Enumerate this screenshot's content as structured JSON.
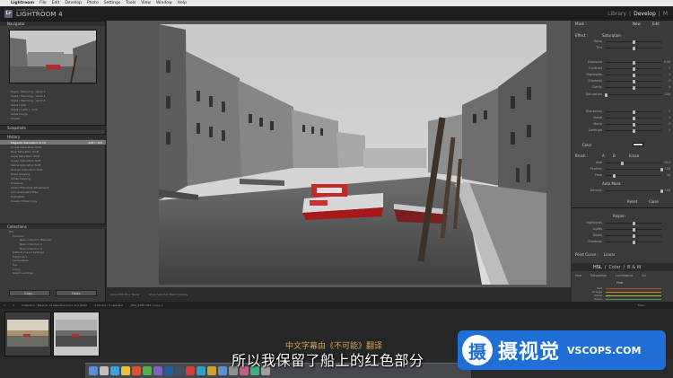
{
  "menubar": {
    "apple": "",
    "items": [
      "Lightroom",
      "File",
      "Edit",
      "Develop",
      "Photo",
      "Settings",
      "Tools",
      "View",
      "Window",
      "Help"
    ]
  },
  "header": {
    "logo": "Lr",
    "brand_small": "ADOBE PHOTOSHOP",
    "brand_big": "LIGHTROOM 4",
    "modules": [
      "Library",
      "Develop"
    ],
    "module_sep": "|",
    "module_more": "M",
    "active_module": "Develop"
  },
  "left_panel": {
    "navigator_title": "Navigator",
    "preset_items": [
      "Sepia / Warming - Level 1",
      "Sepia / Warming - Level 2",
      "Sepia / Warming - Level 3",
      "Sepia Light",
      "Sepia / Light + Look",
      "Sepia Image",
      "Create"
    ],
    "snapshots_title": "Snapshots",
    "history_title": "History",
    "history_items": [
      {
        "label": "Magenta Saturation: 0->0",
        "value": "-100 / -100",
        "selected": true
      },
      {
        "label": "Purple Saturation Shift",
        "value": "",
        "selected": false
      },
      {
        "label": "Blue Saturation Shift",
        "value": "",
        "selected": false
      },
      {
        "label": "Aqua Saturation Shift",
        "value": "",
        "selected": false
      },
      {
        "label": "Green Saturation Shift",
        "value": "",
        "selected": false
      },
      {
        "label": "Yellow Saturation Shift",
        "value": "",
        "selected": false
      },
      {
        "label": "Orange Saturation Shift",
        "value": "",
        "selected": false
      },
      {
        "label": "Black Clipping",
        "value": "",
        "selected": false
      },
      {
        "label": "White Clipping",
        "value": "",
        "selected": false
      },
      {
        "label": "Exposure",
        "value": "",
        "selected": false
      },
      {
        "label": "Added Exposure Adjustment",
        "value": "",
        "selected": false
      },
      {
        "label": "Add Graduated Filter",
        "value": "",
        "selected": false
      },
      {
        "label": "Highlights",
        "value": "",
        "selected": false
      },
      {
        "label": "Create Virtual Copy",
        "value": "",
        "selected": false
      }
    ],
    "collections_title": "Collections",
    "collection_items": [
      "Bot",
      "Premium",
      "New collection  Website",
      "New collection 2",
      "New collection 3",
      "Default Import Settings",
      "Export Pics",
      "Landscapes",
      "Ilce",
      "Lowry",
      "Grant Landings"
    ],
    "copy_label": "Copy...",
    "paste_label": "Paste"
  },
  "toolbar": {
    "before_after": "Show Edit Pins: Never",
    "show_overlay": "Show Selected Mask Overlay"
  },
  "right_panel": {
    "mask_label": "Mask :",
    "new_label": "New",
    "edit_label": "Edit",
    "effect_label": "Effect :",
    "effect_value": "Saturation",
    "sliders": [
      {
        "label": "Temp",
        "pos": 50,
        "value": ""
      },
      {
        "label": "Tint",
        "pos": 50,
        "value": ""
      },
      {
        "label": "Exposure",
        "pos": 50,
        "value": "0.00"
      },
      {
        "label": "Contrast",
        "pos": 50,
        "value": "0"
      },
      {
        "label": "Highlights",
        "pos": 50,
        "value": "0"
      },
      {
        "label": "Shadows",
        "pos": 50,
        "value": "0"
      },
      {
        "label": "Clarity",
        "pos": 50,
        "value": "0"
      },
      {
        "label": "Saturation",
        "pos": 0,
        "value": "-100"
      },
      {
        "label": "Sharpness",
        "pos": 50,
        "value": "0"
      },
      {
        "label": "Noise",
        "pos": 50,
        "value": "0"
      },
      {
        "label": "Moire",
        "pos": 50,
        "value": "0"
      },
      {
        "label": "Defringe",
        "pos": 50,
        "value": "0"
      }
    ],
    "color_label": "Color",
    "brush_label": "Brush :",
    "brush_a": "A",
    "brush_b": "B",
    "erase_label": "Erase",
    "brush_sliders": [
      {
        "label": "Size",
        "pos": 30,
        "value": "15.0"
      },
      {
        "label": "Feather",
        "pos": 100,
        "value": "100"
      },
      {
        "label": "Flow",
        "pos": 15,
        "value": "14"
      },
      {
        "label": "Density",
        "pos": 100,
        "value": "100"
      }
    ],
    "auto_mask": "Auto Mask",
    "reset_label": "Reset",
    "close_label": "Close",
    "region_label": "Region",
    "region_sliders": [
      {
        "label": "Highlights",
        "pos": 50
      },
      {
        "label": "Lights",
        "pos": 50
      },
      {
        "label": "Darks",
        "pos": 50
      },
      {
        "label": "Shadows",
        "pos": 50
      }
    ],
    "point_curve_label": "Point Curve :",
    "point_curve_value": "Linear",
    "hsl_tabs": [
      "HSL",
      "/",
      "Color",
      "/",
      "B & W"
    ],
    "hsl_sub": [
      "Hue",
      "Saturation",
      "Luminance",
      "All"
    ],
    "hue_label": "Hue",
    "hue_sliders": [
      "Red",
      "Orange",
      "Yellow",
      "Green"
    ]
  },
  "filmbar": {
    "page_a": "1",
    "page_b": "2",
    "path": "Collection : Episode 14 selective black and white",
    "count": "3 photos / 1 selected",
    "file": "_IMG_5986.CR2 / Copy 1",
    "filter": "Filter :"
  },
  "subtitles": {
    "cn_top": "中文字幕由《不可能》翻译",
    "cn_main": "所以我保留了船上的红色部分"
  },
  "watermark": {
    "symbol": "摄",
    "cn": "摄视觉",
    "en": "VSCOPS.COM"
  }
}
